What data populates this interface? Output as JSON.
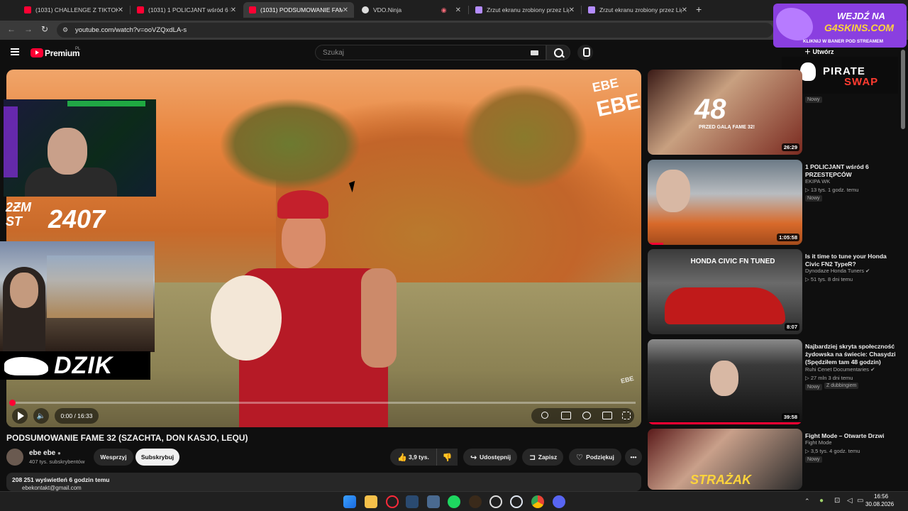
{
  "browser": {
    "tabs": [
      {
        "title": "(1031) CHALLENGE Z TIKTOKA",
        "active": false
      },
      {
        "title": "(1031) 1 POLICJANT wśród 6 PR",
        "active": false
      },
      {
        "title": "(1031) PODSUMOWANIE FAME 3",
        "active": true
      },
      {
        "title": "VDO.Ninja",
        "active": false
      },
      {
        "title": "Zrzut ekranu zrobiony przez Lig",
        "active": false
      },
      {
        "title": "Zrzut ekranu zrobiony przez Lig",
        "active": false
      }
    ],
    "new_tab": "+",
    "close": "✕",
    "url": "youtube.com/watch?v=ooVZQxdLA-s"
  },
  "ad": {
    "line1": "WEJDŹ NA",
    "line2": "G4SKINS.COM",
    "line3": "KLIKNIJ W BANER POD STREAMEM"
  },
  "pirate": {
    "p1": "PIRATE",
    "p2": "SWAP"
  },
  "youtube": {
    "brand": "Premium",
    "region": "PL",
    "search_placeholder": "Szukaj",
    "create_label": "Utwórz"
  },
  "player": {
    "time": "0:00 / 16:33",
    "watermark_small": "EBE",
    "logo_top": "EBE",
    "logo_bottom": "EBE",
    "progress": 0
  },
  "overlays": {
    "tag_mono": "2ƵM\nST",
    "tag_number": "2407",
    "dzik": "DZIK"
  },
  "video": {
    "title": "PODSUMOWANIE FAME 32 (SZACHTA, DON KASJO, LEQU)",
    "channel": "ebe ebe",
    "subscribers": "407 tys. subskrybentów",
    "support": "Wesprzyj",
    "subscribe": "Subskrybuj",
    "likes": "3,9 tys.",
    "share": "Udostępnij",
    "save": "Zapisz",
    "thanks": "Podziękuj",
    "more": "•••",
    "stats": "208 251 wyświetleń  6 godzin temu",
    "desc_line": "ebekontakt@gmail.com"
  },
  "recommendations": [
    {
      "title": "",
      "channel": "",
      "meta": "",
      "badge": "Nowy",
      "duration": "26:29",
      "thumb_text": "48",
      "thumb_sub": "PRZED GALĄ FAME 32!"
    },
    {
      "title": "1 POLICJANT wśród 6 PRZESTĘPCÓW",
      "channel": "EKIPA WK",
      "meta": "▷ 13 tys.  1 godz. temu",
      "badge": "Nowy",
      "duration": "1:05:58",
      "watched": 0.1
    },
    {
      "title": "Is it time to tune your Honda Civic FN2 TypeR?",
      "channel": "Dynodaze Honda Tuners ✔",
      "meta": "▷ 51 tys.  8 dni temu",
      "badge": "",
      "duration": "8:07",
      "thumb_text": "HONDA CIVIC FN TUNED"
    },
    {
      "title": "Najbardziej skryta społeczność żydowska na świecie: Chasydzi (Spędziłem tam 48 godzin)",
      "channel": "Ruhi Cenet Documentaries ✔",
      "meta": "▷ 27 mln  3 dni temu",
      "badge": "Nowy",
      "badge2": "Z dubbingiem",
      "duration": "39:58",
      "watched": 1.0
    },
    {
      "title": "Fight Mode – Otwarte Drzwi",
      "channel": "Fight Mode",
      "meta": "▷ 3,5 tys.  4 godz. temu",
      "badge": "Nowy",
      "duration": "",
      "thumb_text": "STRAŻAK"
    }
  ],
  "clock": {
    "time": "16:56",
    "date": "30.08.2026"
  },
  "colors": {
    "yt_red": "#ff0033",
    "bg": "#0f0f0f",
    "ad_purple": "#8a3fe0"
  }
}
